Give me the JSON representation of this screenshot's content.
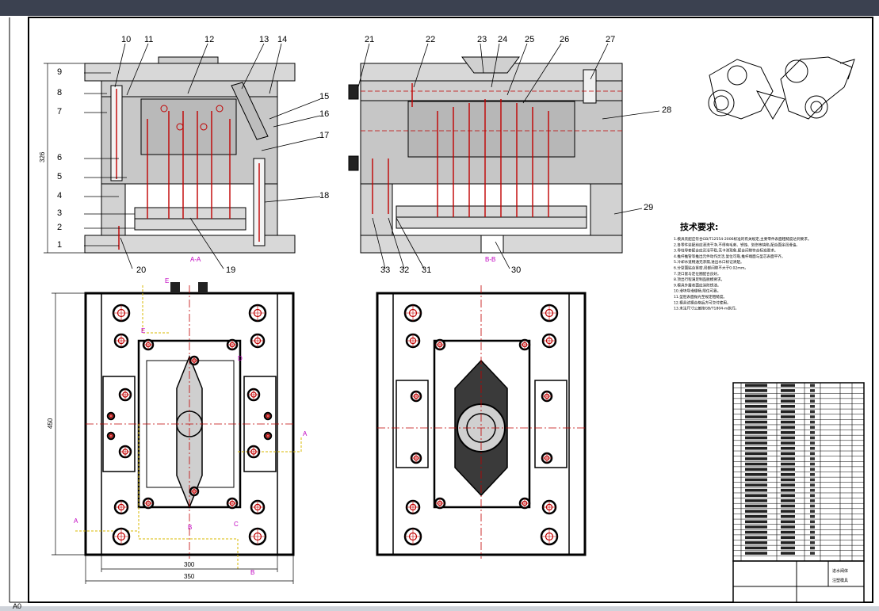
{
  "sheet_label": "A0",
  "part_numbers_left": [
    "1",
    "2",
    "3",
    "4",
    "5",
    "6",
    "7",
    "8",
    "9",
    "10",
    "11",
    "12",
    "13",
    "14",
    "15",
    "16",
    "17",
    "18",
    "19",
    "20"
  ],
  "part_numbers_right": [
    "21",
    "22",
    "23",
    "24",
    "25",
    "26",
    "27",
    "28",
    "29",
    "30",
    "31",
    "32",
    "33"
  ],
  "section_labels": {
    "left": "A-A",
    "right": "B-B"
  },
  "dimensions": {
    "height_326": "326",
    "height_450": "450",
    "width_300": "300",
    "width_350": "350"
  },
  "plan_markers": [
    "A",
    "A",
    "B",
    "B",
    "C",
    "D",
    "E",
    "E"
  ],
  "tech_requirements": {
    "title": "技术要求:",
    "lines": [
      "1.模具装配应符合GB/T12554-2006标准的有关规定,主要零件表面粗糙度达到要求。",
      "2.各零件装配前应清洗干净,不得有毛刺、锈蚀、划伤等缺陷,配合面涂润滑油。",
      "3.导柱导套配合应灵活平稳,无卡滞现象,配合间隙符合标准要求。",
      "4.推杆推管等推出元件动作灵活,复位可靠,推杆端面与型芯表面平齐。",
      "5.冷却水道畅通无渗漏,进出水口标记清楚。",
      "6.分型面贴合紧密,局部间隙不大于0.02mm。",
      "7.浇口套与定位圈配合良好。",
      "8.顶出行程满足制品脱模要求。",
      "9.模具外露表面应涂防锈漆。",
      "10.滑块导滑顺畅,限位可靠。",
      "11.型腔表面抛光至规定粗糙度。",
      "12.模具试模合格后方可交付使用。",
      "13.未注尺寸公差按GB/T1804-m执行。"
    ]
  },
  "title_block": {
    "part": "进水阀体",
    "row_count": 33,
    "mold": "注塑模具"
  }
}
